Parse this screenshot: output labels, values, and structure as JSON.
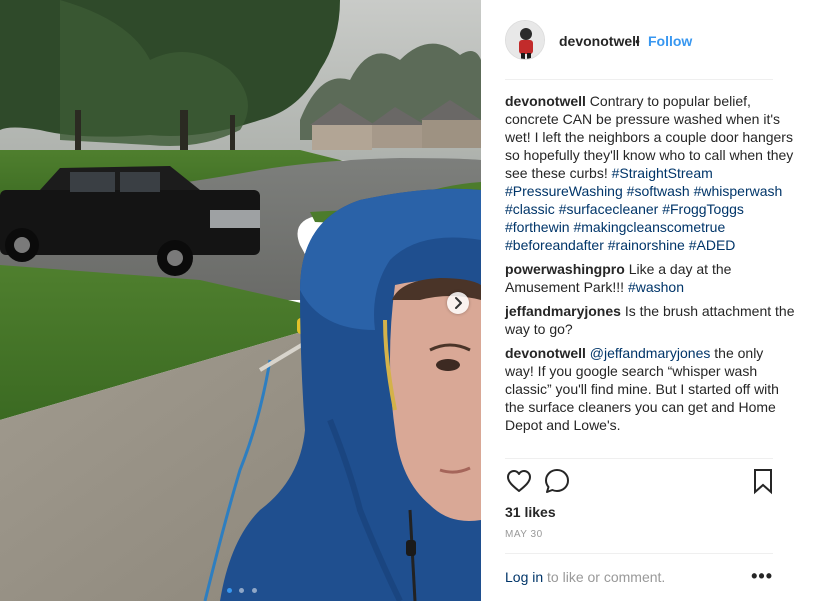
{
  "post": {
    "author": "devonotwell",
    "separator": "•",
    "follow_label": "Follow"
  },
  "comments": [
    {
      "user": "devonotwell",
      "text": "Contrary to popular belief, concrete CAN be pressure washed when it's wet! I left the neighbors a couple door hangers so hopefully they'll know who to call when they see these curbs!",
      "hashtags": [
        "#StraightStream",
        "#PressureWashing",
        "#softwash",
        "#whisperwash",
        "#classic",
        "#surfacecleaner",
        "#FroggToggs",
        "#forthewin",
        "#makingcleanscometrue",
        "#beforeandafter",
        "#rainorshine",
        "#ADED"
      ]
    },
    {
      "user": "powerwashingpro",
      "text": "Like a day at the Amusement Park!!!",
      "hashtags": [
        "#washon"
      ]
    },
    {
      "user": "jeffandmaryjones",
      "text": "Is the brush attachment the way to go?"
    },
    {
      "user": "devonotwell",
      "mention": "@jeffandmaryjones",
      "text": "the only way! If you google search “whisper wash classic” you'll find mine. But I started off with the surface cleaners you can get and Home Depot and Lowe's."
    }
  ],
  "actions": {
    "like_icon": "heart-icon",
    "comment_icon": "comment-icon",
    "save_icon": "bookmark-icon"
  },
  "likes_label": "31 likes",
  "date_label": "MAY 30",
  "login": {
    "link": "Log in",
    "rest": " to like or comment.",
    "more": "•••"
  },
  "carousel": {
    "count": 3,
    "active_index": 0
  },
  "colors": {
    "link_blue": "#3897f0",
    "hashtag_blue": "#003569",
    "jacket_blue": "#1f4f8f"
  }
}
